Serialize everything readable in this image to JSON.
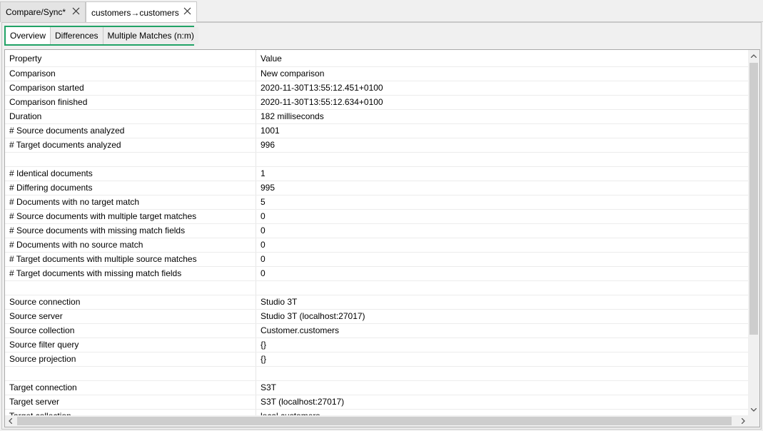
{
  "tabs": [
    {
      "label": "Compare/Sync*",
      "active": false
    },
    {
      "label": "customers→customers",
      "active": true
    }
  ],
  "sub_tabs": [
    {
      "label": "Overview",
      "active": true
    },
    {
      "label": "Differences",
      "active": false
    },
    {
      "label": "Multiple Matches (n:m)",
      "active": false
    }
  ],
  "grid": {
    "columns": [
      "Property",
      "Value"
    ],
    "rows": [
      [
        "Comparison",
        "New comparison"
      ],
      [
        "Comparison started",
        "2020-11-30T13:55:12.451+0100"
      ],
      [
        "Comparison finished",
        "2020-11-30T13:55:12.634+0100"
      ],
      [
        "Duration",
        "182 milliseconds"
      ],
      [
        "# Source documents analyzed",
        "1001"
      ],
      [
        "# Target documents analyzed",
        "996"
      ],
      [
        "",
        ""
      ],
      [
        "# Identical documents",
        "1"
      ],
      [
        "# Differing documents",
        "995"
      ],
      [
        "# Documents with no target match",
        "5"
      ],
      [
        "# Source documents with multiple target matches",
        "0"
      ],
      [
        "# Source documents with missing match fields",
        "0"
      ],
      [
        "# Documents with no source match",
        "0"
      ],
      [
        "# Target documents with multiple source matches",
        "0"
      ],
      [
        "# Target documents with missing match fields",
        "0"
      ],
      [
        "",
        ""
      ],
      [
        "Source connection",
        "Studio 3T"
      ],
      [
        "Source server",
        "Studio 3T (localhost:27017)"
      ],
      [
        "Source collection",
        "Customer.customers"
      ],
      [
        "Source filter query",
        "{}"
      ],
      [
        "Source projection",
        "{}"
      ],
      [
        "",
        ""
      ],
      [
        "Target connection",
        "S3T"
      ],
      [
        "Target server",
        "S3T (localhost:27017)"
      ],
      [
        "Target collection",
        "local.customers"
      ]
    ]
  },
  "icons": {
    "tab_close": "close-icon",
    "scroll_up": "chevron-up-icon",
    "scroll_down": "chevron-down-icon",
    "scroll_left": "chevron-left-icon",
    "scroll_right": "chevron-right-icon"
  },
  "colors": {
    "highlight_border": "#21a366",
    "tab_active_bg": "#ffffff",
    "tab_inactive_bg": "#e4e4e4"
  }
}
